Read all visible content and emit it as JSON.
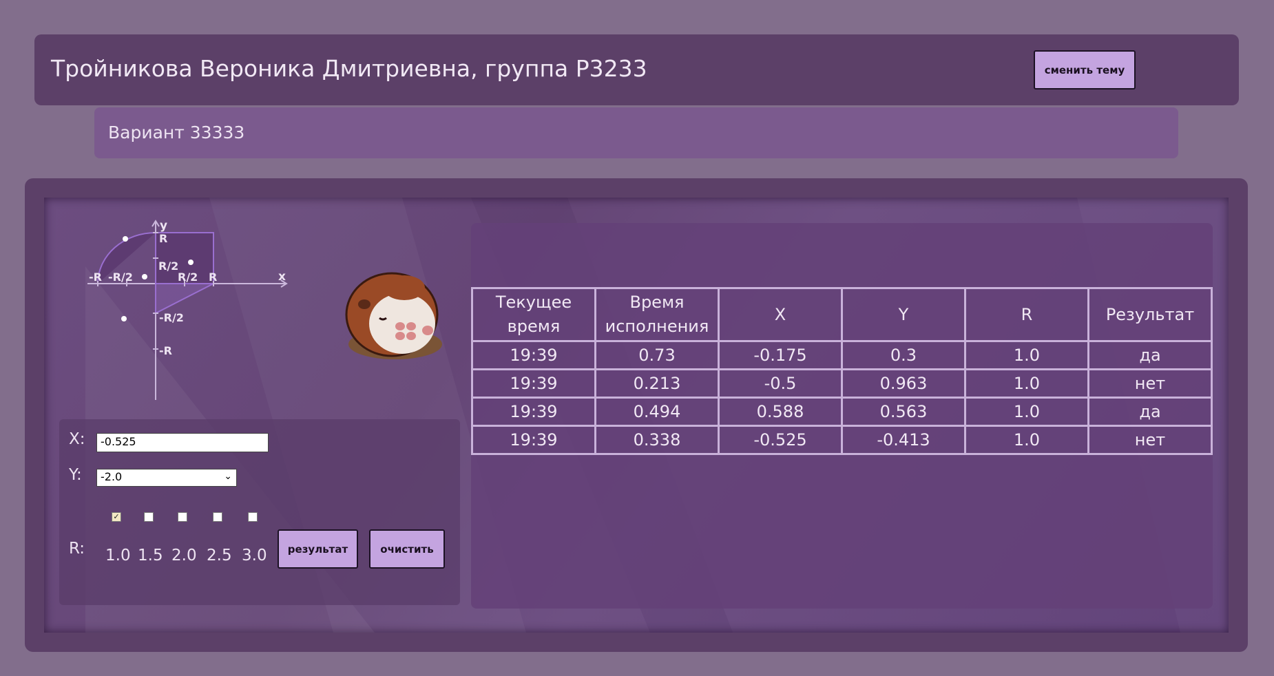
{
  "header": {
    "title": "Тройникова Вероника Дмитриевна, группа P3233",
    "theme_button": "сменить тему"
  },
  "variant": {
    "text": "Вариант 33333"
  },
  "graph": {
    "axis_x": "x",
    "axis_y": "y",
    "labels": {
      "r_top": "R",
      "half_r_top": "R/2",
      "neg_r_left": "-R",
      "neg_half_r_left": "-R/2",
      "half_r_right": "R/2",
      "r_right": "R",
      "neg_half_r_bottom": "-R/2",
      "neg_r_bottom": "-R"
    }
  },
  "form": {
    "x_label": "X:",
    "x_value": "-0.525",
    "y_label": "Y:",
    "y_value": "-2.0",
    "r_label": "R:",
    "r_options": [
      "1.0",
      "1.5",
      "2.0",
      "2.5",
      "3.0"
    ],
    "r_checked": "1.0",
    "submit_label": "результат",
    "clear_label": "очистить"
  },
  "table": {
    "headers": [
      "Текущее время",
      "Время исполнения",
      "X",
      "Y",
      "R",
      "Результат"
    ],
    "rows": [
      [
        "19:39",
        "0.73",
        "-0.175",
        "0.3",
        "1.0",
        "да"
      ],
      [
        "19:39",
        "0.213",
        "-0.5",
        "0.963",
        "1.0",
        "нет"
      ],
      [
        "19:39",
        "0.494",
        "0.588",
        "0.563",
        "1.0",
        "да"
      ],
      [
        "19:39",
        "0.338",
        "-0.525",
        "-0.413",
        "1.0",
        "нет"
      ]
    ]
  },
  "colors": {
    "page_bg": "#826e8c",
    "header_bg": "#5c4068",
    "variant_bg": "#7b5a8e",
    "button_bg": "#c4a4e0",
    "table_border": "#c9b2da",
    "graph_line": "#9a6fd0"
  }
}
